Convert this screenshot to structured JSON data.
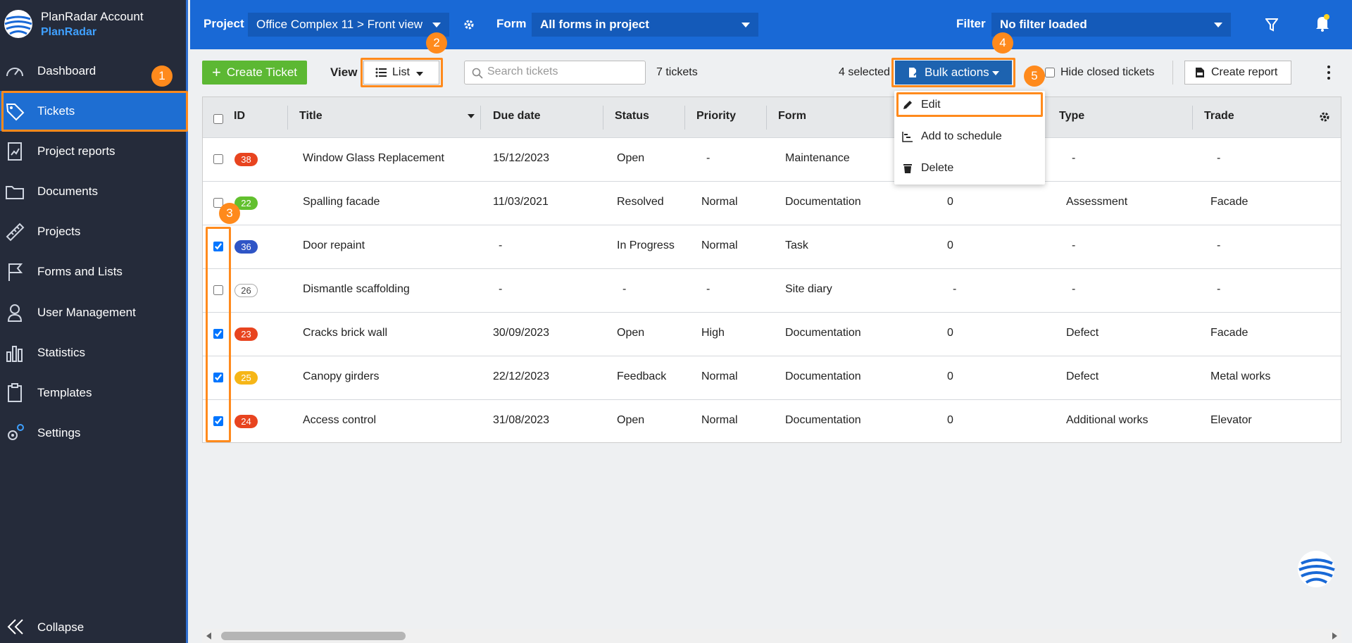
{
  "sidebar": {
    "account_name": "PlanRadar Account",
    "account_org": "PlanRadar",
    "items": [
      {
        "label": "Dashboard",
        "icon": "speedometer-icon"
      },
      {
        "label": "Tickets",
        "icon": "tag-icon",
        "active": true
      },
      {
        "label": "Project reports",
        "icon": "report-icon"
      },
      {
        "label": "Documents",
        "icon": "folder-icon"
      },
      {
        "label": "Projects",
        "icon": "ruler-icon"
      },
      {
        "label": "Forms and Lists",
        "icon": "flag-icon"
      },
      {
        "label": "User Management",
        "icon": "user-icon"
      },
      {
        "label": "Statistics",
        "icon": "bar-chart-icon"
      },
      {
        "label": "Templates",
        "icon": "clipboard-icon"
      },
      {
        "label": "Settings",
        "icon": "gear-icon"
      }
    ],
    "collapse_label": "Collapse"
  },
  "topbar": {
    "project_label": "Project",
    "project_value": "Office Complex 11 > Front view",
    "form_label": "Form",
    "form_value": "All forms in project",
    "filter_label": "Filter",
    "filter_value": "No filter loaded"
  },
  "toolbar": {
    "create_label": "Create Ticket",
    "view_label": "View",
    "view_value": "List",
    "search_placeholder": "Search tickets",
    "ticket_count": "7 tickets",
    "selected_count": "4 selected",
    "bulk_label": "Bulk actions",
    "hide_closed_label": "Hide closed tickets",
    "report_label": "Create report"
  },
  "bulk_menu": [
    "Edit",
    "Add to schedule",
    "Delete"
  ],
  "table": {
    "headers": [
      "ID",
      "Title",
      "Due date",
      "Status",
      "Priority",
      "Form",
      "Type",
      "Trade"
    ],
    "rows": [
      {
        "id": "38",
        "color": "#e8441f",
        "checked": false,
        "title": "Window Glass Replacement",
        "due": "15/12/2023",
        "status": "Open",
        "priority": "-",
        "form": "Maintenance",
        "count": "",
        "type": "-",
        "trade": "-"
      },
      {
        "id": "22",
        "color": "#62c02e",
        "checked": false,
        "title": "Spalling facade",
        "due": "11/03/2021",
        "status": "Resolved",
        "priority": "Normal",
        "form": "Documentation",
        "count": "0",
        "type": "Assessment",
        "trade": "Facade"
      },
      {
        "id": "36",
        "color": "#2f55c6",
        "checked": true,
        "title": "Door repaint",
        "due": "-",
        "status": "In Progress",
        "priority": "Normal",
        "form": "Task",
        "count": "0",
        "type": "-",
        "trade": "-"
      },
      {
        "id": "26",
        "color": "#ffffff",
        "checked": false,
        "title": "Dismantle scaffolding",
        "due": "-",
        "status": "-",
        "priority": "-",
        "form": "Site diary",
        "count": "-",
        "type": "-",
        "trade": "-"
      },
      {
        "id": "23",
        "color": "#e8441f",
        "checked": true,
        "title": "Cracks brick wall",
        "due": "30/09/2023",
        "status": "Open",
        "priority": "High",
        "form": "Documentation",
        "count": "0",
        "type": "Defect",
        "trade": "Facade"
      },
      {
        "id": "25",
        "color": "#f6b617",
        "checked": true,
        "title": "Canopy girders",
        "due": "22/12/2023",
        "status": "Feedback",
        "priority": "Normal",
        "form": "Documentation",
        "count": "0",
        "type": "Defect",
        "trade": "Metal works"
      },
      {
        "id": "24",
        "color": "#e8441f",
        "checked": true,
        "title": "Access control",
        "due": "31/08/2023",
        "status": "Open",
        "priority": "Normal",
        "form": "Documentation",
        "count": "0",
        "type": "Additional works",
        "trade": "Elevator"
      }
    ]
  },
  "step_badges": [
    "1",
    "2",
    "3",
    "4",
    "5"
  ],
  "colors": {
    "accent": "#1969d6",
    "highlight": "#ff8a1c",
    "create": "#5cb833"
  }
}
